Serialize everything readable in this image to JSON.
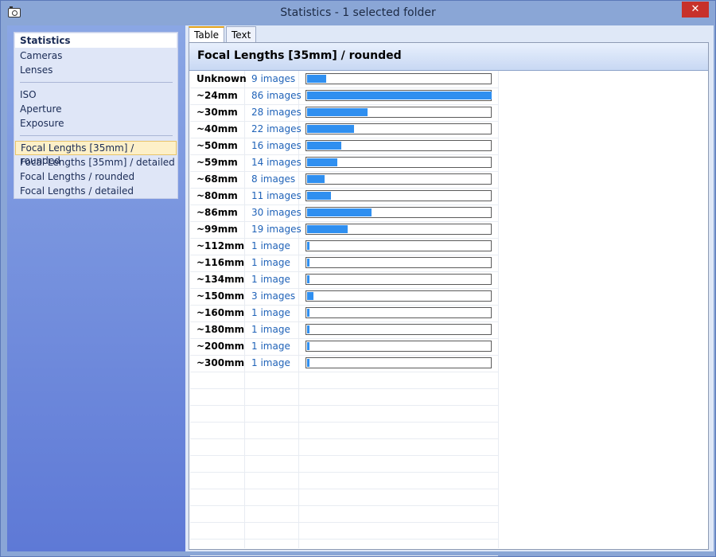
{
  "window": {
    "title": "Statistics - 1 selected folder",
    "close_label": "✕"
  },
  "nav": {
    "items": [
      {
        "label": "Statistics",
        "header": true
      },
      {
        "label": "Cameras"
      },
      {
        "label": "Lenses"
      },
      {
        "label": "ISO"
      },
      {
        "label": "Aperture"
      },
      {
        "label": "Exposure"
      },
      {
        "label": "Focal Lengths [35mm] / rounded",
        "selected": true
      },
      {
        "label": "Focal Lengths [35mm] / detailed"
      },
      {
        "label": "Focal Lengths / rounded"
      },
      {
        "label": "Focal Lengths / detailed"
      }
    ]
  },
  "tabs": [
    {
      "label": "Table",
      "active": true
    },
    {
      "label": "Text"
    }
  ],
  "section": {
    "title": "Focal Lengths [35mm] / rounded"
  },
  "rows": [
    {
      "label": "Unknown",
      "count": "9 images",
      "value": 9
    },
    {
      "label": "~24mm",
      "count": "86 images",
      "value": 86
    },
    {
      "label": "~30mm",
      "count": "28 images",
      "value": 28
    },
    {
      "label": "~40mm",
      "count": "22 images",
      "value": 22
    },
    {
      "label": "~50mm",
      "count": "16 images",
      "value": 16
    },
    {
      "label": "~59mm",
      "count": "14 images",
      "value": 14
    },
    {
      "label": "~68mm",
      "count": "8 images",
      "value": 8
    },
    {
      "label": "~80mm",
      "count": "11 images",
      "value": 11
    },
    {
      "label": "~86mm",
      "count": "30 images",
      "value": 30
    },
    {
      "label": "~99mm",
      "count": "19 images",
      "value": 19
    },
    {
      "label": "~112mm",
      "count": "1 image",
      "value": 1
    },
    {
      "label": "~116mm",
      "count": "1 image",
      "value": 1
    },
    {
      "label": "~134mm",
      "count": "1 image",
      "value": 1
    },
    {
      "label": "~150mm",
      "count": "3 images",
      "value": 3
    },
    {
      "label": "~160mm",
      "count": "1 image",
      "value": 1
    },
    {
      "label": "~180mm",
      "count": "1 image",
      "value": 1
    },
    {
      "label": "~200mm",
      "count": "1 image",
      "value": 1
    },
    {
      "label": "~300mm",
      "count": "1 image",
      "value": 1
    }
  ],
  "colors": {
    "bar": "#2f8ff0",
    "count_text": "#1f62b8"
  }
}
